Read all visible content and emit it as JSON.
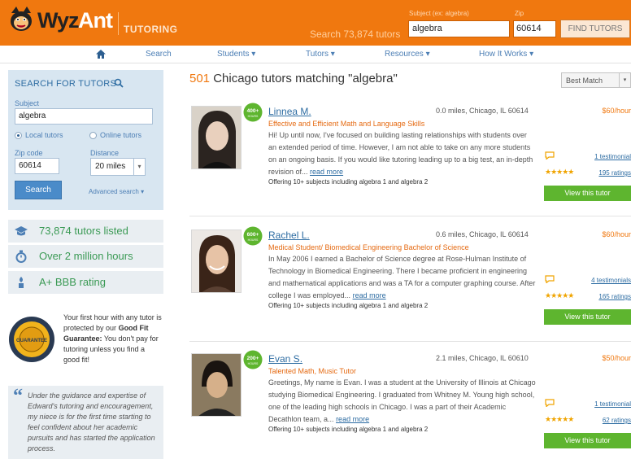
{
  "header": {
    "logo_wyz": "Wyz",
    "logo_ant": "Ant",
    "logo_tutoring": "TUTORING",
    "tutor_count": "Search 73,874 tutors",
    "subject_label": "Subject (ex: algebra)",
    "zip_label": "Zip",
    "subject_value": "algebra",
    "zip_value": "60614",
    "find_button": "FIND TUTORS",
    "accent_color": "#f0780f"
  },
  "nav": {
    "home_icon": "home-icon",
    "items": [
      "Search",
      "Students",
      "Tutors",
      "Resources",
      "How It Works"
    ]
  },
  "sidebar": {
    "search_title": "SEARCH FOR TUTORS",
    "subject_label": "Subject",
    "subject_value": "algebra",
    "local_tutors": "Local tutors",
    "online_tutors": "Online tutors",
    "zip_label": "Zip code",
    "zip_value": "60614",
    "distance_label": "Distance",
    "distance_value": "20 miles",
    "search_button": "Search",
    "advanced_search": "Advanced search",
    "stats": [
      "73,874 tutors listed",
      "Over 2 million hours",
      "A+ BBB rating"
    ],
    "guarantee_pre": "Your first hour with any tutor is protected by our",
    "guarantee_bold": "Good Fit Guarantee:",
    "guarantee_post": "You don't pay for tutoring unless you find a good fit!",
    "seal_text": "GUARANTEE",
    "quote": "Under the guidance and expertise of Edward's tutoring and encouragement, my niece is for the first time starting to feel confident about her academic pursuits and has started the application process."
  },
  "results": {
    "count": "501",
    "title_rest": "Chicago tutors matching \"algebra\"",
    "sort_value": "Best Match",
    "tutors": [
      {
        "badge": "400+",
        "badge_sub": "HOURS",
        "name": "Linnea M.",
        "location": "0.0 miles, Chicago, IL 60614",
        "rate": "$60/hour",
        "tagline": "Effective and Efficient Math and Language Skills",
        "bio": "Hi! Up until now, I've focused on building lasting relationships with students over an extended period of time. However, I am not able to take on any more students on an ongoing basis. If you would like tutoring leading up to a big test, an in-depth revision of...",
        "read_more": "read more",
        "offering": "Offering 10+ subjects including algebra 1 and algebra 2",
        "testimonials": "1 testimonial",
        "stars": "★★★★★",
        "ratings": "195 ratings",
        "view_button": "View this tutor"
      },
      {
        "badge": "600+",
        "badge_sub": "HOURS",
        "name": "Rachel L.",
        "location": "0.6 miles, Chicago, IL 60614",
        "rate": "$60/hour",
        "tagline": "Medical Student/ Biomedical Engineering Bachelor of Science",
        "bio": "In May 2006 I earned a Bachelor of Science degree at Rose-Hulman Institute of Technology in Biomedical Engineering. There I became proficient in engineering and mathematical applications and was a TA for a computer graphing course. After college I was employed...",
        "read_more": "read more",
        "offering": "Offering 10+ subjects including algebra 1 and algebra 2",
        "testimonials": "4 testimonials",
        "stars": "★★★★★",
        "ratings": "165 ratings",
        "view_button": "View this tutor"
      },
      {
        "badge": "200+",
        "badge_sub": "HOURS",
        "name": "Evan S.",
        "location": "2.1 miles, Chicago, IL 60610",
        "rate": "$50/hour",
        "tagline": "Talented Math, Music Tutor",
        "bio": "Greetings, My name is Evan. I was a student at the University of Illinois at Chicago studying Biomedical Engineering. I graduated from Whitney M. Young high school, one of the leading high schools in Chicago. I was a part of their Academic Decathlon team, a...",
        "read_more": "read more",
        "offering": "Offering 10+ subjects including algebra 1 and algebra 2",
        "testimonials": "1 testimonial",
        "stars": "★★★★★",
        "ratings": "62 ratings",
        "view_button": "View this tutor"
      }
    ]
  }
}
